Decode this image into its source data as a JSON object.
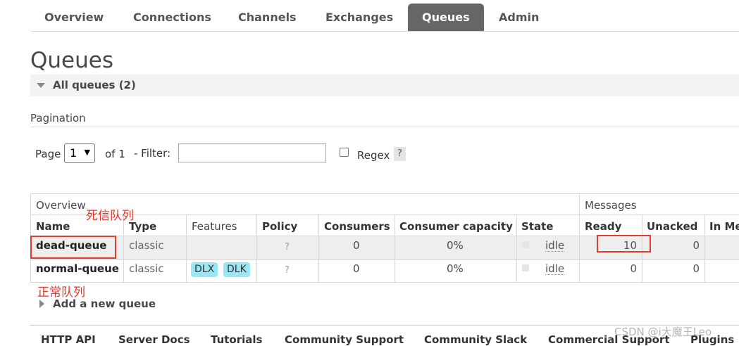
{
  "nav": {
    "tabs": [
      {
        "label": "Overview"
      },
      {
        "label": "Connections"
      },
      {
        "label": "Channels"
      },
      {
        "label": "Exchanges"
      },
      {
        "label": "Queues",
        "active": true
      },
      {
        "label": "Admin"
      }
    ]
  },
  "page_title": "Queues",
  "section": {
    "label": "All queues (2)"
  },
  "pagination": {
    "label": "Pagination",
    "page_label": "Page",
    "page_value": "1",
    "of_label": "of 1",
    "filter_label": "- Filter:",
    "filter_value": "",
    "regex_label": "Regex",
    "help": "?"
  },
  "table": {
    "groups": {
      "overview": "Overview",
      "messages": "Messages"
    },
    "headers": {
      "name": "Name",
      "type": "Type",
      "features": "Features",
      "policy": "Policy",
      "consumers": "Consumers",
      "consumer_capacity": "Consumer capacity",
      "state": "State",
      "ready": "Ready",
      "unacked": "Unacked",
      "in_memory": "In Me"
    },
    "rows": [
      {
        "name": "dead-queue",
        "type": "classic",
        "features": [],
        "policy": "?",
        "consumers": "0",
        "capacity": "0%",
        "state": "idle",
        "ready": "10",
        "unacked": "0"
      },
      {
        "name": "normal-queue",
        "type": "classic",
        "features": [
          "DLX",
          "DLK"
        ],
        "policy": "?",
        "consumers": "0",
        "capacity": "0%",
        "state": "idle",
        "ready": "0",
        "unacked": "0"
      }
    ]
  },
  "annotations": {
    "dead": "死信队列",
    "normal": "正常队列"
  },
  "add_queue": "Add a new queue",
  "footer": {
    "links": [
      "HTTP API",
      "Server Docs",
      "Tutorials",
      "Community Support",
      "Community Slack",
      "Commercial Support",
      "Plugins"
    ]
  },
  "watermark": "CSDN @i大魔王Leo",
  "colors": {
    "active_tab": "#666666",
    "badge": "#99e6f4",
    "annotation": "#e8352a"
  }
}
